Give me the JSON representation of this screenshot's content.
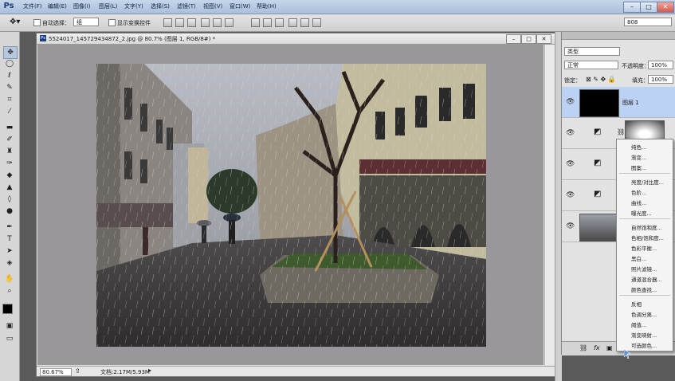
{
  "app": {
    "logo": "Ps"
  },
  "menu": [
    "文件(F)",
    "编辑(E)",
    "图像(I)",
    "图层(L)",
    "文字(Y)",
    "选择(S)",
    "滤镜(T)",
    "视图(V)",
    "窗口(W)",
    "帮助(H)"
  ],
  "window_controls": [
    "–",
    "□",
    "✕"
  ],
  "options": {
    "auto_select_label": "自动选择：",
    "auto_select_value": "组",
    "show_transform_label": "显示变换控件",
    "workspace_value": "808"
  },
  "document": {
    "title": "5524017_145729434872_2.jpg @ 80.7% (图层 1, RGB/8#) *",
    "zoom": "80.67%",
    "doc_size": "文档:2.17M/5.93M"
  },
  "layers_panel": {
    "kind_filter": "类型",
    "blend_mode": "正常",
    "opacity_label": "不透明度：",
    "opacity_value": "100%",
    "lock_label": "锁定：",
    "fill_label": "填充：",
    "fill_value": "100%",
    "layer1_name": "图层 1",
    "footer_icons": [
      "link-icon",
      "fx-icon",
      "mask-icon"
    ]
  },
  "context_menu": {
    "group1": [
      "纯色...",
      "渐变...",
      "图案..."
    ],
    "group2": [
      "亮度/对比度...",
      "色阶...",
      "曲线...",
      "曝光度..."
    ],
    "group3": [
      "自然饱和度...",
      "色相/饱和度...",
      "色彩平衡...",
      "黑白...",
      "照片滤镜...",
      "通道混合器...",
      "颜色查找..."
    ],
    "group4": [
      "反相",
      "色调分离...",
      "阈值...",
      "渐变映射...",
      "可选颜色..."
    ]
  }
}
